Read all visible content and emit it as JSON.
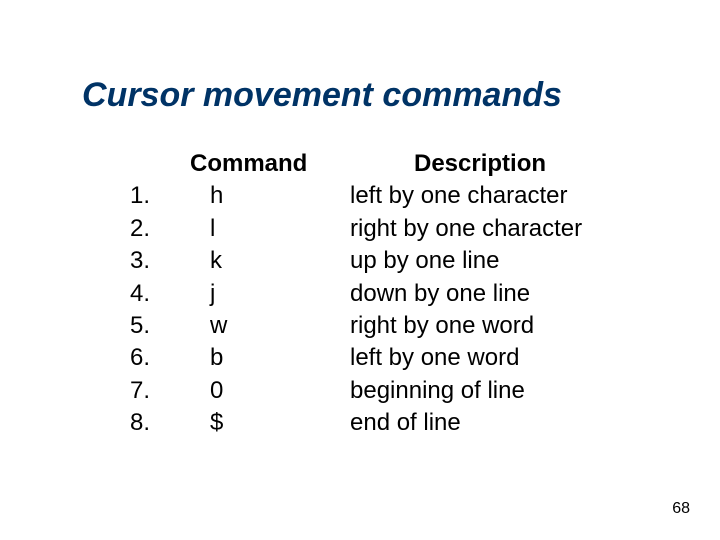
{
  "title": "Cursor movement commands",
  "headers": {
    "command": "Command",
    "description": "Description"
  },
  "rows": [
    {
      "num": "1.",
      "cmd": "h",
      "desc": "left by one character"
    },
    {
      "num": "2.",
      "cmd": "l",
      "desc": "right by one character"
    },
    {
      "num": "3.",
      "cmd": "k",
      "desc": "up by one line"
    },
    {
      "num": "4.",
      "cmd": "j",
      "desc": "down by one line"
    },
    {
      "num": "5.",
      "cmd": "w",
      "desc": "right by one word"
    },
    {
      "num": "6.",
      "cmd": "b",
      "desc": "left by one word"
    },
    {
      "num": "7.",
      "cmd": "0",
      "desc": "beginning of line"
    },
    {
      "num": "8.",
      "cmd": "$",
      "desc": "end of line"
    }
  ],
  "page_number": "68"
}
